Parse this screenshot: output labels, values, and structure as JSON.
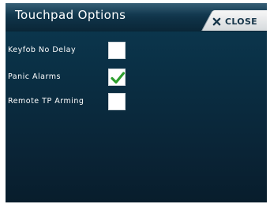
{
  "header": {
    "title": "Touchpad  Options",
    "close_label": "CLOSE"
  },
  "options": [
    {
      "label": "Keyfob  No  Delay",
      "checked": false
    },
    {
      "label": "Panic  Alarms",
      "checked": true
    },
    {
      "label": "Remote  TP  Arming",
      "checked": false
    }
  ],
  "colors": {
    "background": "#0a2f44",
    "check": "#2e9e2e",
    "close_tab": "#e8ebed"
  },
  "icons": {
    "close": "close-icon",
    "check": "check-icon"
  }
}
